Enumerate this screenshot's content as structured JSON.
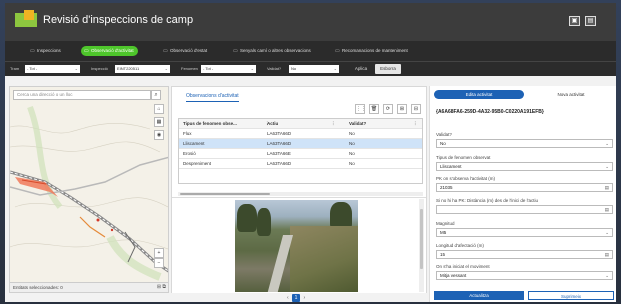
{
  "header": {
    "title": "Revisió d'inspeccions de camp",
    "buttons": [
      "▣",
      "▤"
    ]
  },
  "tabs": [
    {
      "label": "Inspeccions"
    },
    {
      "label": "Observació d'activitat"
    },
    {
      "label": "Observació d'estat"
    },
    {
      "label": "Senyals camí o altres observacions"
    },
    {
      "label": "Recomanacions de manteniment"
    }
  ],
  "filters": {
    "tram": {
      "label": "Tram",
      "value": "- Tot -"
    },
    "inspeccio": {
      "label": "Inspecció",
      "value": "EINT220511"
    },
    "fenomen": {
      "label": "Fenomen",
      "value": "- Tot -"
    },
    "validat": {
      "label": "Validat?",
      "value": "No"
    },
    "apply_label": "Aplica",
    "clear_label": "Esborra"
  },
  "map": {
    "search_placeholder": "Cerca una direcció o un lloc",
    "tools": [
      "⌂",
      "+",
      "−",
      "▦",
      "◉"
    ],
    "status_text": "Entitats seleccionades: 0"
  },
  "observations": {
    "tab_label": "Observacions d'activitat",
    "toolbar": [
      "⋮⋮",
      "🗑",
      "⟳",
      "⊞",
      "⊟"
    ],
    "columns": [
      "Tipus de fenomen obse...",
      "Actiu",
      "Validat?"
    ],
    "rows": [
      {
        "tipus": "Flux",
        "actiu": "LA63TA66D",
        "validat": "No"
      },
      {
        "tipus": "Lliscament",
        "actiu": "LA63TA66D",
        "validat": "No"
      },
      {
        "tipus": "Erosió",
        "actiu": "LA63TA66E",
        "validat": "No"
      },
      {
        "tipus": "Despreniment",
        "actiu": "LA63TA66D",
        "validat": "No"
      }
    ]
  },
  "pager": {
    "current": "1",
    "prev": "‹",
    "next": "›"
  },
  "side": {
    "tab_edit": "Edita activitat",
    "tab_new": "Nova activitat",
    "record_id": "{A6A68FA6-259D-4A32-95B0-C0220A191EFB}",
    "fields": [
      {
        "label": "Validat?",
        "value": "No",
        "dropdown": true
      },
      {
        "label": "Tipus de fenomen observat",
        "value": "Lliscament",
        "dropdown": true
      },
      {
        "label": "PK on s'observa l'activitat (m)",
        "value": "21035",
        "dropdown": false
      },
      {
        "label": "Si no hi ha PK: Distància (m) des de l'inici de l'actiu",
        "value": "",
        "dropdown": false
      },
      {
        "label": "Magnitud",
        "value": "M5",
        "dropdown": true
      },
      {
        "label": "Longitud d'afectació (m)",
        "value": "15",
        "dropdown": false
      },
      {
        "label": "On s'ha iniciat el moviment",
        "value": "Mitja vessant",
        "dropdown": true
      }
    ],
    "update_label": "Actualitza",
    "delete_label": "Suprimeix"
  }
}
